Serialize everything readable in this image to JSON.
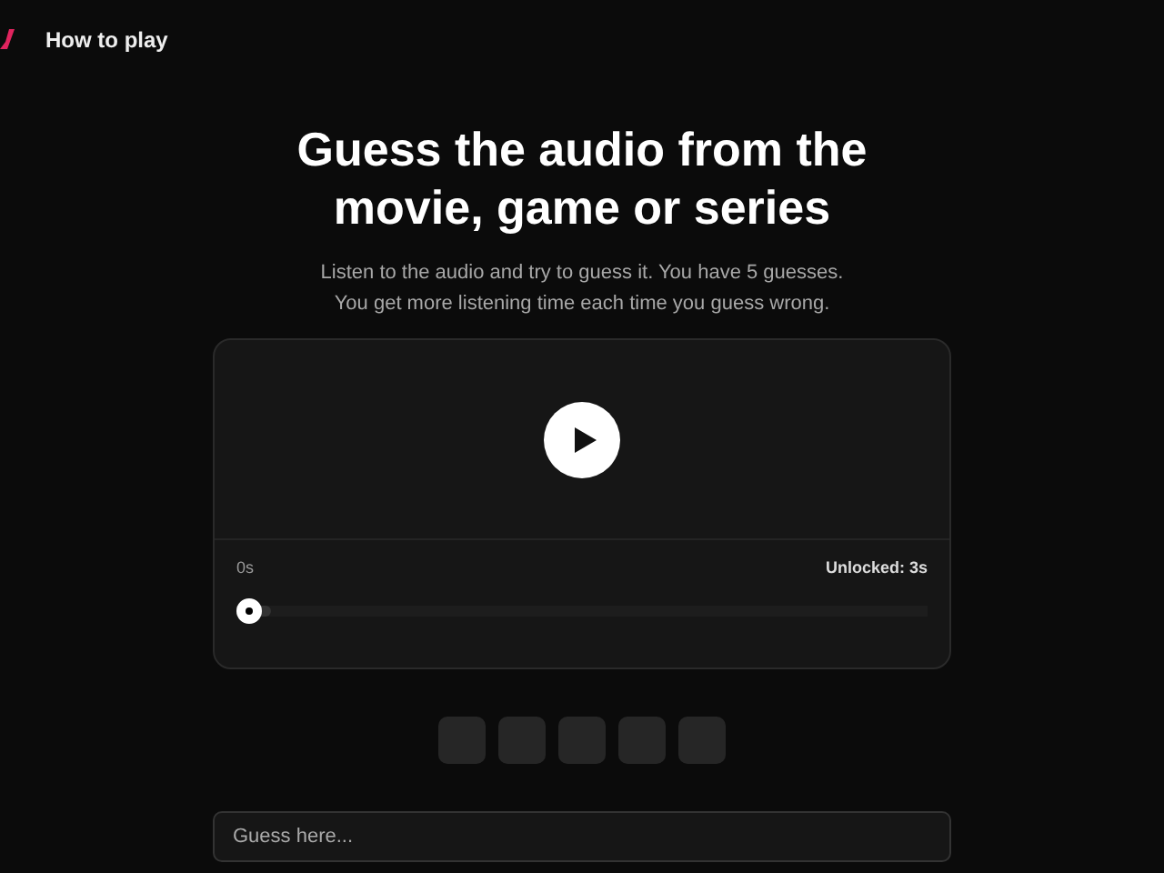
{
  "nav": {
    "link": "How to play"
  },
  "heading": {
    "title": "Guess the audio from the movie, game or series",
    "subtitle": "Listen to the audio and try to guess it. You have 5 guesses.\nYou get more listening time each time you guess wrong."
  },
  "player": {
    "elapsed": "0s",
    "unlocked_label": "Unlocked: 3s",
    "progress": {
      "level": 0
    },
    "unlocked": {
      "level": 0.05
    }
  },
  "guesses": [
    {
      "filled": false
    },
    {
      "filled": false
    },
    {
      "filled": false
    },
    {
      "filled": false
    },
    {
      "filled": false
    }
  ],
  "guess_input": {
    "placeholder": "Guess here..."
  }
}
